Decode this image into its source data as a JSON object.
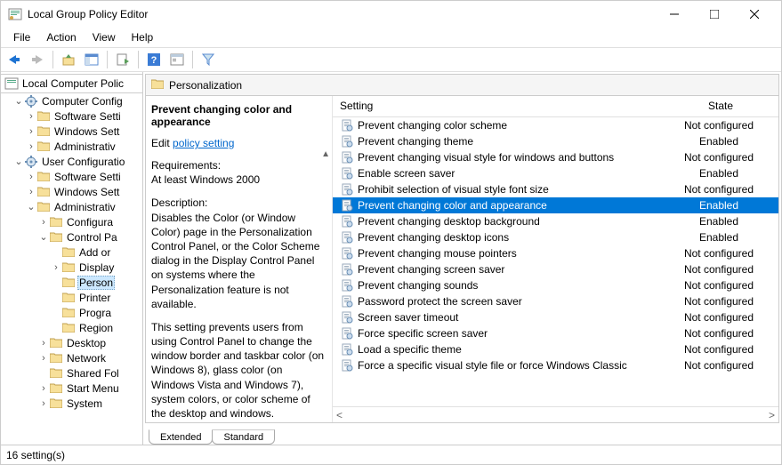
{
  "window": {
    "title": "Local Group Policy Editor"
  },
  "menu": {
    "file": "File",
    "action": "Action",
    "view": "View",
    "help": "Help"
  },
  "tree": {
    "root": "Local Computer Polic",
    "computer_config": "Computer Config",
    "cc_software": "Software Setti",
    "cc_windows": "Windows Sett",
    "cc_admin": "Administrativ",
    "user_config": "User Configuratio",
    "uc_software": "Software Setti",
    "uc_windows": "Windows Sett",
    "uc_admin": "Administrativ",
    "configura": "Configura",
    "control_pa": "Control Pa",
    "add_or": "Add or",
    "display": "Display",
    "person": "Person",
    "printer": "Printer",
    "progra": "Progra",
    "region": "Region",
    "desktop": "Desktop",
    "network": "Network",
    "shared_fol": "Shared Fol",
    "start_menu": "Start Menu",
    "system": "System"
  },
  "path": {
    "label": "Personalization"
  },
  "desc": {
    "title": "Prevent changing color and appearance",
    "edit_prefix": "Edit ",
    "edit_link": "policy setting",
    "req_label": "Requirements:",
    "req_text": "At least Windows 2000",
    "desc_label": "Description:",
    "desc_text": "Disables the Color (or Window Color) page in the Personalization Control Panel, or the Color Scheme dialog in the Display Control Panel on systems where the Personalization feature is not available.",
    "desc_text2": "This setting prevents users from using Control Panel to change the window border and taskbar color (on Windows 8), glass color (on Windows Vista and Windows 7), system colors, or color scheme of the desktop and windows."
  },
  "columns": {
    "setting": "Setting",
    "state": "State"
  },
  "settings": [
    {
      "label": "Prevent changing color scheme",
      "state": "Not configured"
    },
    {
      "label": "Prevent changing theme",
      "state": "Enabled"
    },
    {
      "label": "Prevent changing visual style for windows and buttons",
      "state": "Not configured"
    },
    {
      "label": "Enable screen saver",
      "state": "Enabled"
    },
    {
      "label": "Prohibit selection of visual style font size",
      "state": "Not configured"
    },
    {
      "label": "Prevent changing color and appearance",
      "state": "Enabled",
      "selected": true
    },
    {
      "label": "Prevent changing desktop background",
      "state": "Enabled"
    },
    {
      "label": "Prevent changing desktop icons",
      "state": "Enabled"
    },
    {
      "label": "Prevent changing mouse pointers",
      "state": "Not configured"
    },
    {
      "label": "Prevent changing screen saver",
      "state": "Not configured"
    },
    {
      "label": "Prevent changing sounds",
      "state": "Not configured"
    },
    {
      "label": "Password protect the screen saver",
      "state": "Not configured"
    },
    {
      "label": "Screen saver timeout",
      "state": "Not configured"
    },
    {
      "label": "Force specific screen saver",
      "state": "Not configured"
    },
    {
      "label": "Load a specific theme",
      "state": "Not configured"
    },
    {
      "label": "Force a specific visual style file or force Windows Classic",
      "state": "Not configured"
    }
  ],
  "tabs": {
    "extended": "Extended",
    "standard": "Standard"
  },
  "status": {
    "text": "16 setting(s)"
  }
}
